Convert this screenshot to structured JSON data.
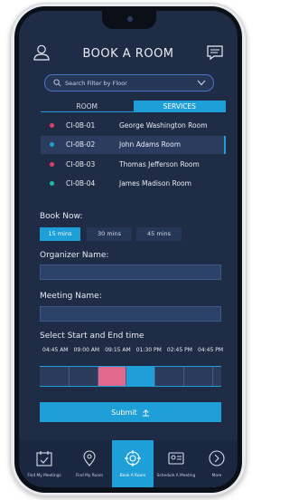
{
  "header": {
    "title": "BOOK A ROOM",
    "left_icon": "user-icon",
    "right_icon": "chat-icon"
  },
  "search": {
    "placeholder": "Search Filter by Floor"
  },
  "tabs": [
    {
      "label": "ROOM",
      "active": false
    },
    {
      "label": "SERVICES",
      "active": true
    }
  ],
  "rooms": [
    {
      "code": "CI-0B-01",
      "name": "George Washington Room",
      "dot": "#e23d6c",
      "selected": false
    },
    {
      "code": "CI-0B-02",
      "name": "John Adams Room",
      "dot": "#1f9fd8",
      "selected": true
    },
    {
      "code": "CI-0B-03",
      "name": "Thomas Jefferson Room",
      "dot": "#e23d6c",
      "selected": false
    },
    {
      "code": "CI-0B-04",
      "name": "James Madison Room",
      "dot": "#1fbf9a",
      "selected": false
    }
  ],
  "book_now": {
    "label": "Book Now:",
    "durations": [
      {
        "label": "15 mins",
        "active": true
      },
      {
        "label": "30 mins",
        "active": false
      },
      {
        "label": "45 mins",
        "active": false
      }
    ]
  },
  "organizer": {
    "label": "Organizer Name:",
    "value": ""
  },
  "meeting": {
    "label": "Meeting Name:",
    "value": ""
  },
  "schedule": {
    "label": "Select Start and End time",
    "times": [
      "04:45 AM",
      "09:00 AM",
      "09:15 AM",
      "01:30 PM",
      "02:45 PM",
      "04:45 PM"
    ],
    "booked_slot_color": "#e0688e",
    "selected_slot_color": "#1f9fd8"
  },
  "submit": {
    "label": "Submit"
  },
  "bottom_nav": [
    {
      "label": "Find My Meetings",
      "icon": "calendar-check-icon",
      "active": false
    },
    {
      "label": "Find My Room",
      "icon": "map-pin-icon",
      "active": false
    },
    {
      "label": "Book A Room",
      "icon": "target-icon",
      "active": true
    },
    {
      "label": "Schedule A Meeting",
      "icon": "id-card-icon",
      "active": false
    },
    {
      "label": "More",
      "icon": "chevron-right-circle-icon",
      "active": false
    }
  ],
  "colors": {
    "accent": "#1f9fd8",
    "background": "#1f2c46"
  }
}
